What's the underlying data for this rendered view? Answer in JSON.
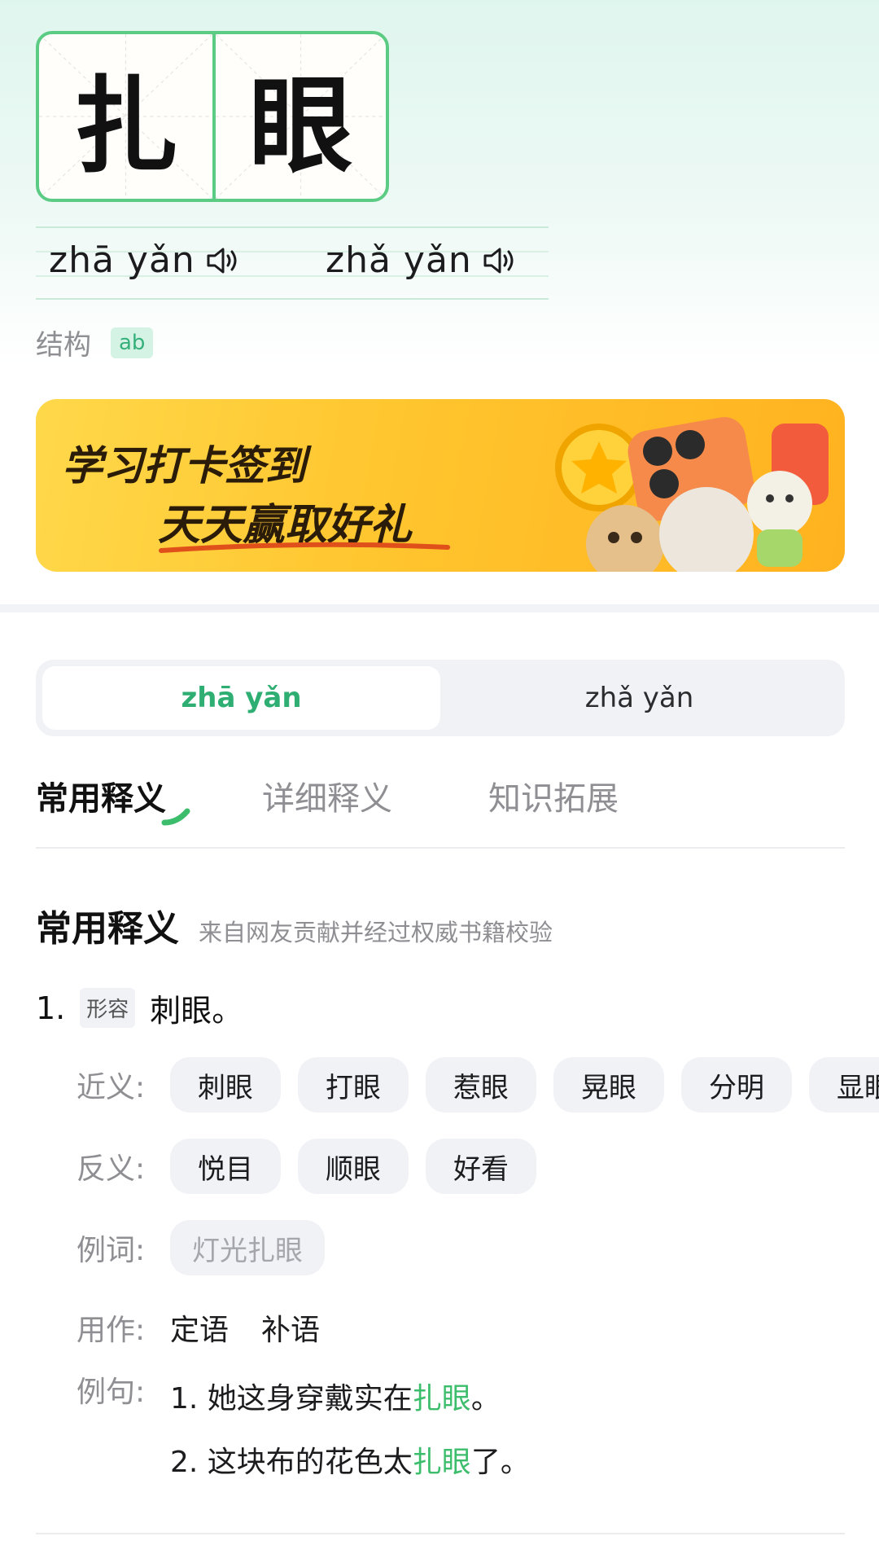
{
  "word": {
    "char1": "扎",
    "char2": "眼"
  },
  "pinyin": {
    "reading1": "zhā  yǎn",
    "reading2": "zhǎ  yǎn"
  },
  "structure": {
    "label": "结构",
    "value": "ab"
  },
  "banner": {
    "line1": "学习打卡签到",
    "line2": "天天赢取好礼"
  },
  "toggle": {
    "options": [
      "zhā yǎn",
      "zhǎ yǎn"
    ],
    "selected": 0
  },
  "tabs": {
    "items": [
      "常用释义",
      "详细释义",
      "知识拓展"
    ],
    "selected": 0
  },
  "section": {
    "title": "常用释义",
    "subtitle": "来自网友贡献并经过权威书籍校验"
  },
  "definition": {
    "number": "1.",
    "pos": "形容",
    "text": "刺眼。",
    "synonyms_label": "近义:",
    "synonyms": [
      "刺眼",
      "打眼",
      "惹眼",
      "晃眼",
      "分明",
      "显眼"
    ],
    "antonyms_label": "反义:",
    "antonyms": [
      "悦目",
      "顺眼",
      "好看"
    ],
    "example_words_label": "例词:",
    "example_words": [
      "灯光扎眼"
    ],
    "usage_label": "用作:",
    "usage": [
      "定语",
      "补语"
    ],
    "sentences_label": "例句:",
    "sentences": [
      {
        "before": "1. 她这身穿戴实在",
        "highlight": "扎眼",
        "after": "。"
      },
      {
        "before": "2. 这块布的花色太",
        "highlight": "扎眼",
        "after": "了。"
      }
    ]
  },
  "colors": {
    "accent_green": "#2fae73",
    "highlight_green": "#3cbd6c",
    "grid_green": "#5ccb84",
    "banner_yellow": "#ffc52e"
  },
  "icons": {
    "speaker": "speaker-icon"
  }
}
